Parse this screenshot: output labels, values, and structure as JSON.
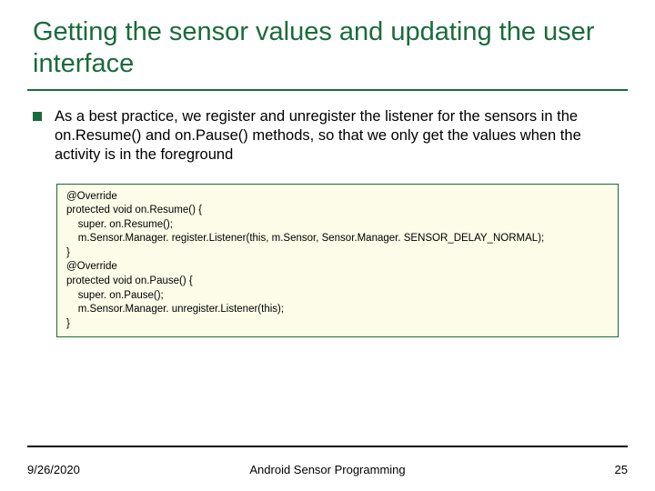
{
  "title": "Getting the sensor values and updating the user interface",
  "body": "As a best practice, we register and unregister the listener for the sensors in the on.Resume() and on.Pause() methods, so that we only get the values when the activity is in the foreground",
  "code": {
    "l0": "@Override",
    "l1": "protected void on.Resume() {",
    "l2": "    super. on.Resume();",
    "l3": "    m.Sensor.Manager. register.Listener(this, m.Sensor, Sensor.Manager. SENSOR_DELAY_NORMAL);",
    "l4": "}",
    "l5": "@Override",
    "l6": "protected void on.Pause() {",
    "l7": "    super. on.Pause();",
    "l8": "    m.Sensor.Manager. unregister.Listener(this);",
    "l9": "}"
  },
  "footer": {
    "date": "9/26/2020",
    "title": "Android Sensor Programming",
    "page": "25"
  }
}
